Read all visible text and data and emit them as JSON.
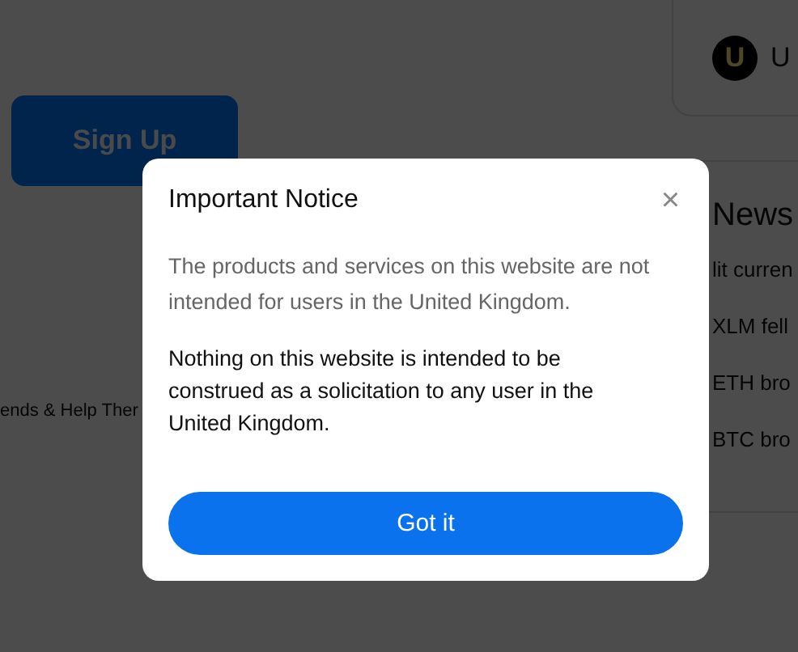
{
  "page": {
    "sign_up_button": "Sign Up",
    "footer_link": "ends & Help Ther"
  },
  "account_card": {
    "logo_letter": "U",
    "name": "U"
  },
  "news": {
    "title": "News",
    "items": [
      "lit curren",
      "XLM fell",
      "ETH bro",
      "BTC bro"
    ]
  },
  "dialog": {
    "title": "Important Notice",
    "close": "×",
    "notice": "The products and services on this website are not intended for users in the United Kingdom.",
    "body": "Nothing on this website is intended to be construed as a solicitation to any user in the United Kingdom.",
    "button": "Got it"
  }
}
